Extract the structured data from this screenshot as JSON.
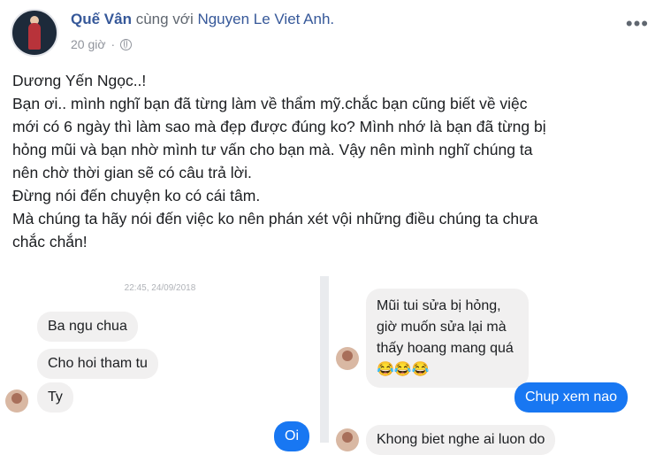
{
  "post": {
    "author": "Quế Vân",
    "with_text": "cùng với",
    "tagged": "Nguyen Le Viet Anh.",
    "time": "20 giờ",
    "more_icon": "•••",
    "body": [
      "Dương Yến Ngọc..!",
      "Bạn ơi.. mình nghĩ bạn đã từng làm về thẩm mỹ.chắc bạn cũng biết về việc",
      "mới có 6 ngày thì làm sao mà đẹp được đúng ko? Mình nhớ là bạn đã từng bị",
      "hỏng mũi và bạn nhờ mình tư vấn cho bạn mà. Vậy nên mình nghĩ chúng ta",
      "nên chờ thời gian sẽ có câu trả lời.",
      "Đừng nói đến chuyện ko có cái tâm.",
      "Mà chúng ta hãy nói đến việc ko nên phán xét vội những điều chúng ta chưa",
      "chắc chắn!"
    ]
  },
  "chat_left": {
    "timestamp": "22:45, 24/09/2018",
    "messages": [
      "Ba ngu chua",
      "Cho hoi tham tu",
      "Ty"
    ],
    "outgoing": [
      "Oi"
    ]
  },
  "chat_right": {
    "incoming_1": "Mũi tui sửa bị hỏng, giờ muốn sửa lại mà thấy hoang mang quá 😂😂😂",
    "outgoing": "Chup xem nao",
    "incoming_2": "Khong biet nghe ai luon do"
  }
}
